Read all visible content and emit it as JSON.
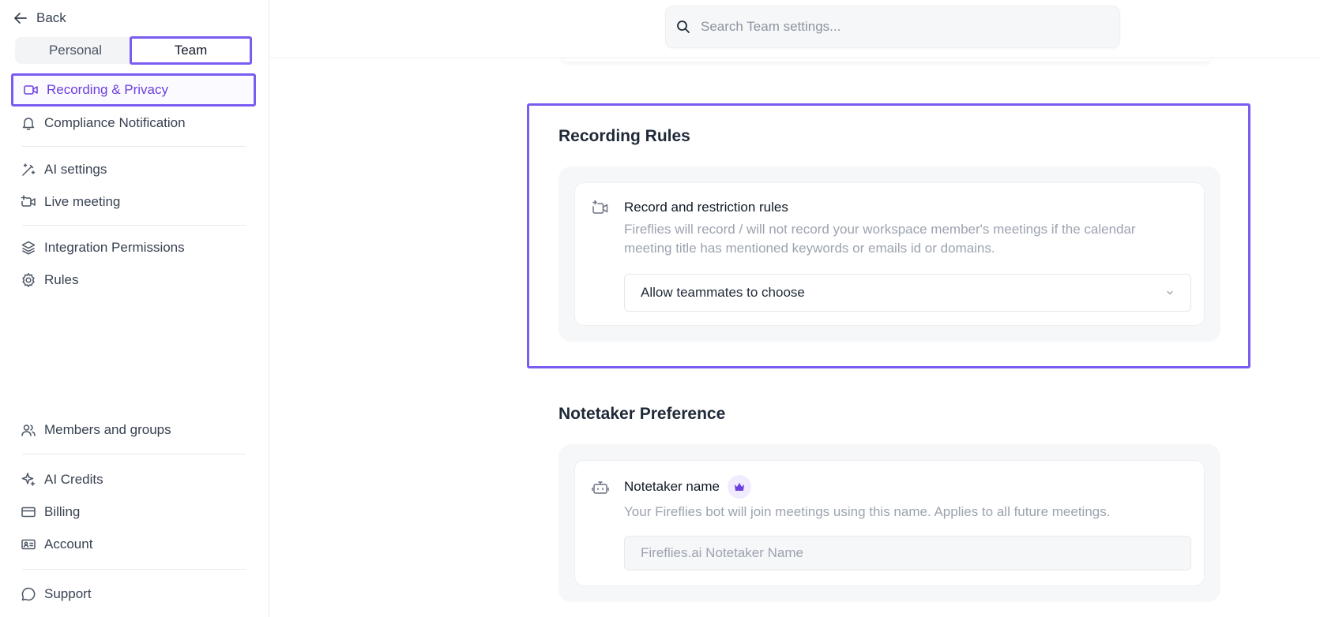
{
  "sidebar": {
    "back_label": "Back",
    "tabs": {
      "personal": "Personal",
      "team": "Team",
      "active": "team"
    },
    "items": [
      {
        "label": "Recording & Privacy",
        "icon": "video-camera-icon",
        "active": true
      },
      {
        "label": "Compliance Notification",
        "icon": "bell-icon"
      },
      {
        "label": "AI settings",
        "icon": "magic-wand-icon"
      },
      {
        "label": "Live meeting",
        "icon": "video-plus-icon"
      },
      {
        "label": "Integration Permissions",
        "icon": "layers-icon"
      },
      {
        "label": "Rules",
        "icon": "gear-icon"
      },
      {
        "label": "Members and groups",
        "icon": "users-icon"
      },
      {
        "label": "AI Credits",
        "icon": "sparkle-icon"
      },
      {
        "label": "Billing",
        "icon": "credit-card-icon"
      },
      {
        "label": "Account",
        "icon": "id-card-icon"
      },
      {
        "label": "Support",
        "icon": "chat-bubble-icon"
      }
    ]
  },
  "search": {
    "placeholder": "Search Team settings..."
  },
  "recording_rules": {
    "title": "Recording Rules",
    "rule_title": "Record and restriction rules",
    "rule_desc": "Fireflies will record / will not record your workspace member's meetings if the calendar meeting title has mentioned keywords or emails id or domains.",
    "select_value": "Allow teammates to choose"
  },
  "notetaker": {
    "title": "Notetaker Preference",
    "name_title": "Notetaker name",
    "name_desc": "Your Fireflies bot will join meetings using this name. Applies to all future meetings.",
    "name_placeholder": "Fireflies.ai Notetaker Name"
  },
  "colors": {
    "accent": "#7b5cf0",
    "active_text": "#6d3fe0",
    "muted": "#9ca3af"
  }
}
